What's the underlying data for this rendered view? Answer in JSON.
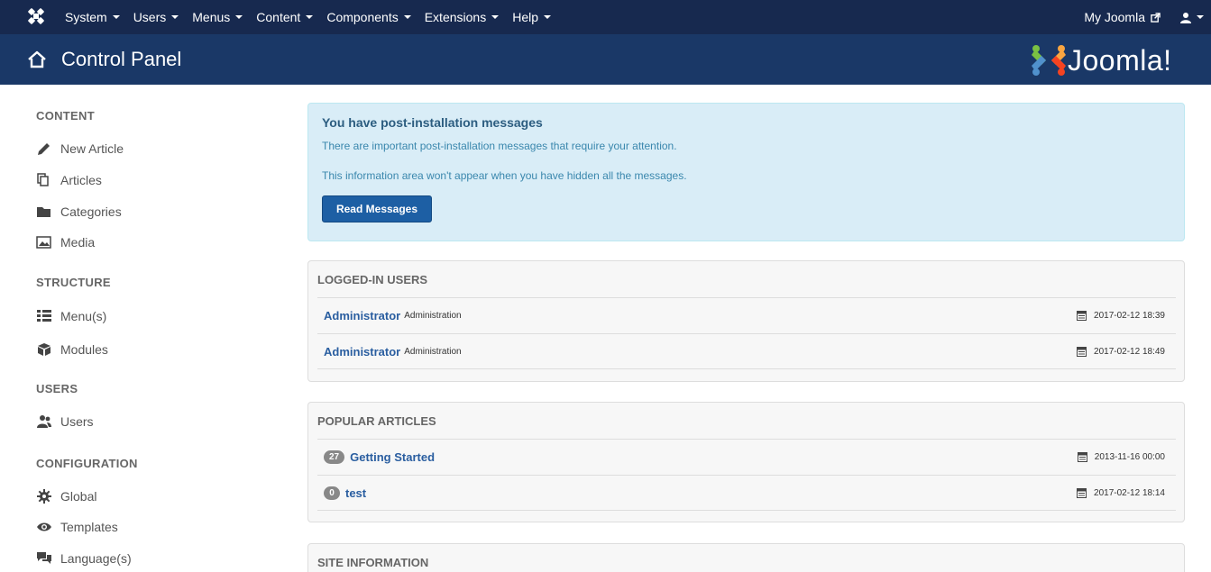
{
  "topbar": {
    "menu": [
      {
        "label": "System",
        "name": "menu-system"
      },
      {
        "label": "Users",
        "name": "menu-users"
      },
      {
        "label": "Menus",
        "name": "menu-menus"
      },
      {
        "label": "Content",
        "name": "menu-content"
      },
      {
        "label": "Components",
        "name": "menu-components"
      },
      {
        "label": "Extensions",
        "name": "menu-extensions"
      },
      {
        "label": "Help",
        "name": "menu-help"
      }
    ],
    "my_joomla": "My Joomla"
  },
  "header": {
    "title": "Control Panel",
    "brand": "Joomla!"
  },
  "sidebar": {
    "headings": [
      "CONTENT",
      "STRUCTURE",
      "USERS",
      "CONFIGURATION"
    ],
    "items": [
      {
        "label": "New Article",
        "icon": "pencil-icon"
      },
      {
        "label": "Articles",
        "icon": "copy-icon"
      },
      {
        "label": "Categories",
        "icon": "folder-icon"
      },
      {
        "label": "Media",
        "icon": "image-icon"
      },
      {
        "label": "Menu(s)",
        "icon": "list-icon"
      },
      {
        "label": "Modules",
        "icon": "cube-icon"
      },
      {
        "label": "Users",
        "icon": "users-icon"
      },
      {
        "label": "Global",
        "icon": "cog-icon"
      },
      {
        "label": "Templates",
        "icon": "eye-icon"
      },
      {
        "label": "Language(s)",
        "icon": "comments-icon"
      }
    ]
  },
  "alert": {
    "title": "You have post-installation messages",
    "line1": "There are important post-installation messages that require your attention.",
    "line2": "This information area won't appear when you have hidden all the messages.",
    "button": "Read Messages"
  },
  "logged_in": {
    "title": "LOGGED-IN USERS",
    "rows": [
      {
        "name": "Administrator",
        "area": "Administration",
        "date": "2017-02-12 18:39"
      },
      {
        "name": "Administrator",
        "area": "Administration",
        "date": "2017-02-12 18:49"
      }
    ]
  },
  "popular": {
    "title": "POPULAR ARTICLES",
    "rows": [
      {
        "hits": "27",
        "title": "Getting Started",
        "date": "2013-11-16 00:00"
      },
      {
        "hits": "0",
        "title": "test",
        "date": "2017-02-12 18:14"
      }
    ]
  },
  "site_info": {
    "title": "SITE INFORMATION"
  },
  "colors": {
    "topbar": "#17294f",
    "header": "#1a3867",
    "alert_bg": "#d9edf7",
    "primary": "#1d5fa4",
    "link": "#2a5ea0"
  }
}
